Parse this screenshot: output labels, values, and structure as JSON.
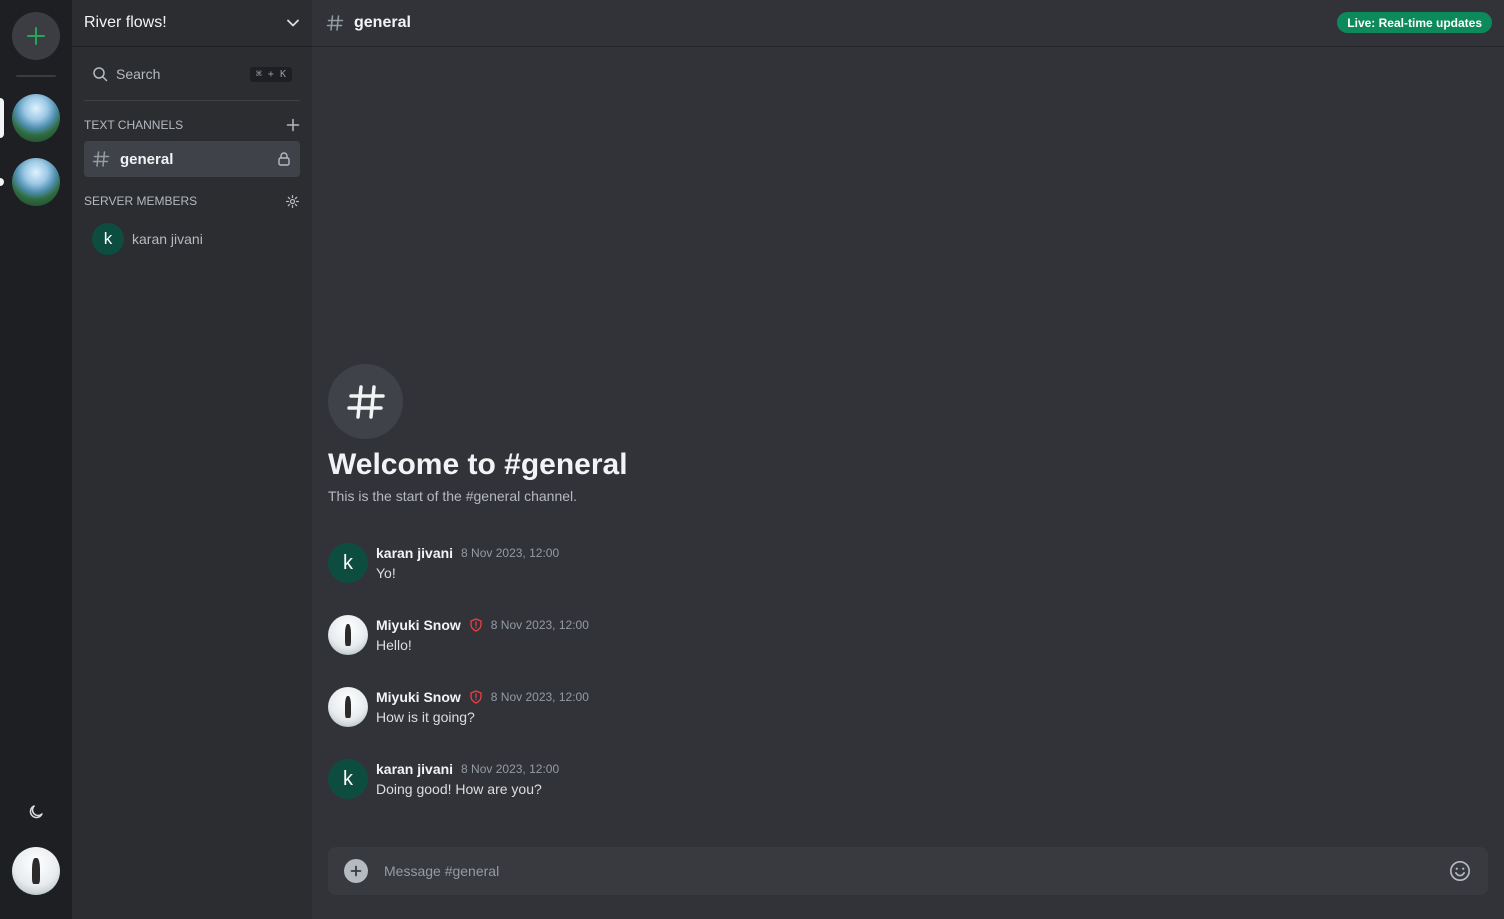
{
  "rail": {
    "add_icon": "plus-icon",
    "servers": [
      {
        "name": "River flows!",
        "active": true
      },
      {
        "name": "",
        "active": false
      }
    ],
    "theme_icon": "moon-icon"
  },
  "sidebar": {
    "server_name": "River flows!",
    "search": {
      "label": "Search",
      "shortcut": "⌘ + K"
    },
    "text_channels_title": "Text Channels",
    "channels": [
      {
        "name": "general",
        "locked": true
      }
    ],
    "members_title": "Server Members",
    "members": [
      {
        "initial": "k",
        "name": "karan jivani"
      }
    ]
  },
  "topbar": {
    "channel": "general",
    "live_badge": "Live: Real-time updates"
  },
  "welcome": {
    "title": "Welcome to #general",
    "subtitle": "This is the start of the #general channel."
  },
  "messages": [
    {
      "author": "karan jivani",
      "initial": "k",
      "moderator": false,
      "time": "8 Nov 2023, 12:00",
      "text": "Yo!"
    },
    {
      "author": "Miyuki Snow",
      "initial": "",
      "moderator": true,
      "time": "8 Nov 2023, 12:00",
      "text": "Hello!"
    },
    {
      "author": "Miyuki Snow",
      "initial": "",
      "moderator": true,
      "time": "8 Nov 2023, 12:00",
      "text": "How is it going?"
    },
    {
      "author": "karan jivani",
      "initial": "k",
      "moderator": false,
      "time": "8 Nov 2023, 12:00",
      "text": "Doing good! How are you?"
    }
  ],
  "composer": {
    "placeholder": "Message #general"
  },
  "colors": {
    "accent_green": "#0d8a5b",
    "moderator_red": "#f23f43",
    "member_avatar": "#0d4d3f"
  }
}
